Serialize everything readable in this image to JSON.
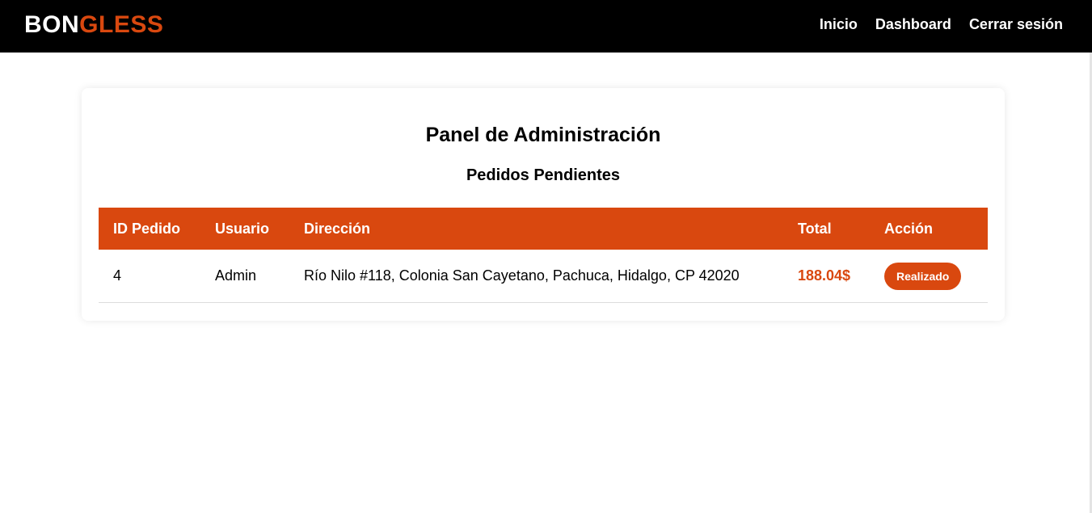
{
  "brand": {
    "part1": "BON",
    "part2": "GLESS"
  },
  "nav": {
    "links": [
      "Inicio",
      "Dashboard",
      "Cerrar sesión"
    ]
  },
  "panel": {
    "title": "Panel de Administración",
    "subtitle": "Pedidos Pendientes"
  },
  "table": {
    "headers": [
      "ID Pedido",
      "Usuario",
      "Dirección",
      "Total",
      "Acción"
    ],
    "rows": [
      {
        "id": "4",
        "user": "Admin",
        "address": "Río Nilo #118, Colonia San Cayetano, Pachuca, Hidalgo, CP 42020",
        "total": "188.04$",
        "action": "Realizado"
      }
    ]
  },
  "colors": {
    "accent": "#d9480f",
    "navbar": "#000000"
  }
}
